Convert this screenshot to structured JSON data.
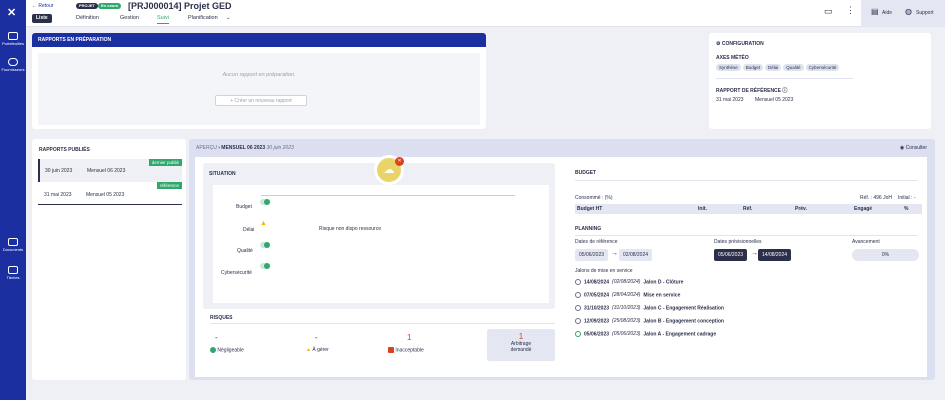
{
  "sidebar": {
    "items": [
      {
        "label": "Portefeuilles"
      },
      {
        "label": "Fournisseurs"
      },
      {
        "label": "Documents"
      },
      {
        "label": "Tâches"
      }
    ]
  },
  "header": {
    "back": "← Retour",
    "tag_projet": "PROJET",
    "tag_status": "En cours",
    "title": "[PRJ000014] Projet GED",
    "liste": "Liste",
    "tabs": [
      "Définition",
      "Gestion",
      "Suivi",
      "Planification"
    ],
    "aide": "Aide",
    "support": "Support"
  },
  "prep": {
    "title": "RAPPORTS EN PRÉPARATION",
    "empty": "Aucun rapport en préparation.",
    "create": "+ Créer un nouveau rapport"
  },
  "config": {
    "title": "CONFIGURATION",
    "axes_title": "AXES MÉTÉO",
    "axes": [
      "Synthèse",
      "Budget",
      "Délai",
      "Qualité",
      "Cybersécurité"
    ],
    "ref_title": "RAPPORT DE RÉFÉRENCE",
    "ref_date": "31 mai 2023",
    "ref_name": "Mensuel 05 2023"
  },
  "published": {
    "title": "RAPPORTS PUBLIÉS",
    "rows": [
      {
        "date": "30 juin 2023",
        "name": "Mensuel 06 2023",
        "badge": "dernier publié"
      },
      {
        "date": "31 mai 2023",
        "name": "Mensuel 05 2023",
        "badge": "référence"
      }
    ]
  },
  "apercu": {
    "label": "APERÇU",
    "name": "MENSUEL 06 2023",
    "date": "30 juin 2023",
    "consult": "Consulter"
  },
  "situation": {
    "title": "SITUATION",
    "rows": [
      {
        "label": "Budget",
        "note": ""
      },
      {
        "label": "Délai",
        "note": "Risque non dispo ressource"
      },
      {
        "label": "Qualité",
        "note": ""
      },
      {
        "label": "Cybersécurité",
        "note": ""
      }
    ]
  },
  "risques": {
    "title": "RISQUES",
    "items": [
      {
        "value": "-",
        "label": "Négligeable",
        "color": "#2ea86b"
      },
      {
        "value": "-",
        "label": "À gérer",
        "color": "#f2b600"
      },
      {
        "value": "1",
        "label": "Inacceptable",
        "color": "#d9421f"
      }
    ],
    "arbitrage_value": "1",
    "arbitrage_label1": "Arbitrage",
    "arbitrage_label2": "demandé"
  },
  "budget": {
    "title": "BUDGET",
    "consomme": "Consommé : (%)",
    "ref": "Réf. : 496 JoH",
    "initial": "Initial : -",
    "cols": [
      "Budget HT",
      "Init.",
      "Réf.",
      "Prév.",
      "Engagé",
      "%"
    ]
  },
  "planning": {
    "title": "PLANNING",
    "ref_label": "Dates de référence",
    "ref_start": "05/06/2023",
    "ref_end": "02/08/2024",
    "prev_label": "Dates prévisionnelles",
    "prev_start": "05/06/2023",
    "prev_end": "14/08/2024",
    "avancement_label": "Avancement",
    "avancement_value": "0%",
    "jalons_title": "Jalons de mise en service",
    "jalons": [
      {
        "d1": "14/08/2024",
        "d2": "(02/08/2024)",
        "name": "Jalon D - Clôture"
      },
      {
        "d1": "07/05/2024",
        "d2": "(28/04/2024)",
        "name": "Mise en service"
      },
      {
        "d1": "31/10/2023",
        "d2": "(31/10/2023)",
        "name": "Jalon C - Engagement Réalisation"
      },
      {
        "d1": "12/09/2023",
        "d2": "(25/08/2023)",
        "name": "Jalon B - Engagement conception"
      },
      {
        "d1": "05/06/2023",
        "d2": "(05/06/2023)",
        "name": "Jalon A - Engagement cadrage"
      }
    ]
  }
}
